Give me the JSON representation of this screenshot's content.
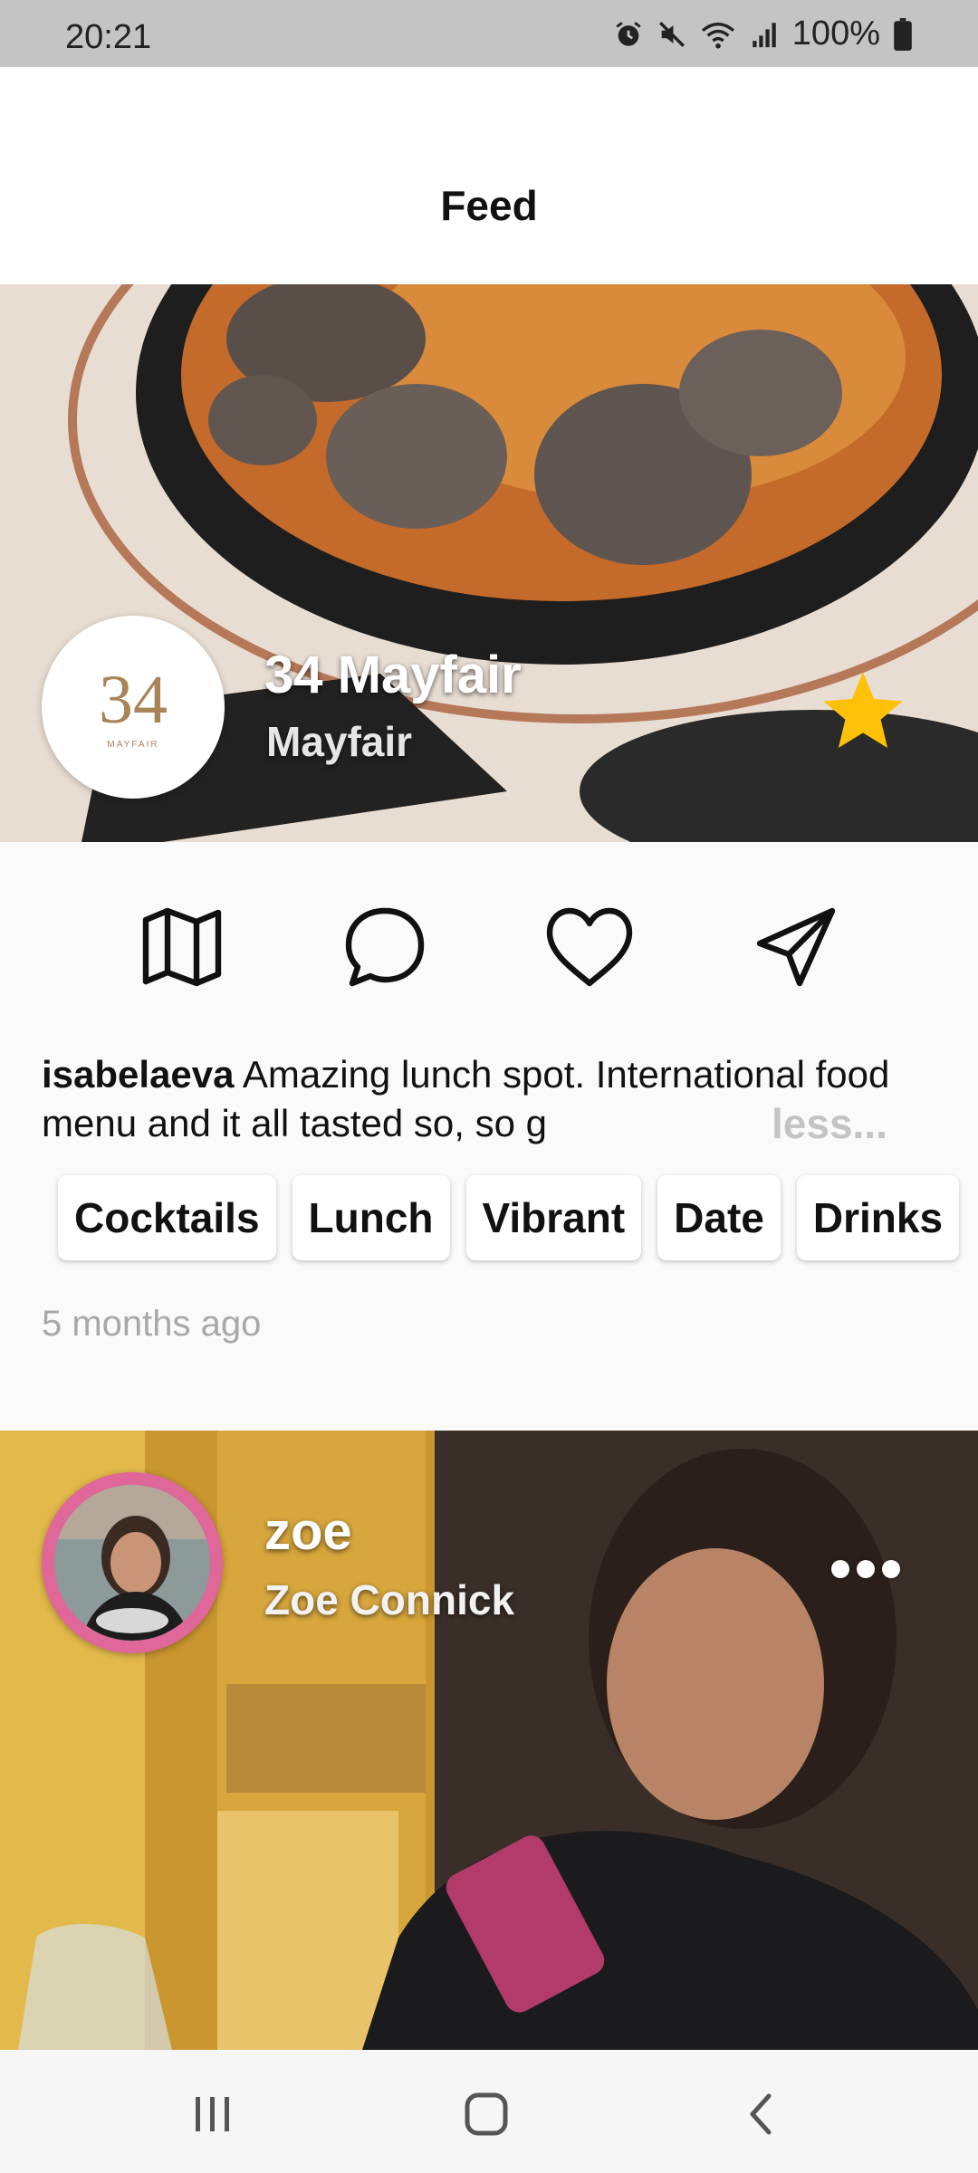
{
  "status_bar": {
    "time": "20:21",
    "battery": "100%",
    "icons": [
      "alarm-icon",
      "mute-icon",
      "wifi-icon",
      "signal-icon",
      "battery-icon"
    ]
  },
  "header": {
    "title": "Feed"
  },
  "post1": {
    "venue": {
      "logo_number": "34",
      "logo_subtext": "MAYFAIR",
      "name": "34 Mayfair",
      "area": "Mayfair",
      "favorited": true
    },
    "actions": [
      "map-icon",
      "comment-icon",
      "heart-icon",
      "share-icon"
    ],
    "caption": {
      "user": "isabelaeva",
      "text": " Amazing lunch spot. International food menu and it all tasted so, so g",
      "toggle": "less..."
    },
    "tags": [
      "Cocktails",
      "Lunch",
      "Vibrant",
      "Date",
      "Drinks"
    ],
    "time": "5 months ago"
  },
  "post2": {
    "user": {
      "handle": "zoe",
      "full_name": "Zoe Connick"
    }
  },
  "colors": {
    "star": "#ffc107",
    "avatar_ring": "#e0679a",
    "muted_text": "#a8a8a8"
  }
}
